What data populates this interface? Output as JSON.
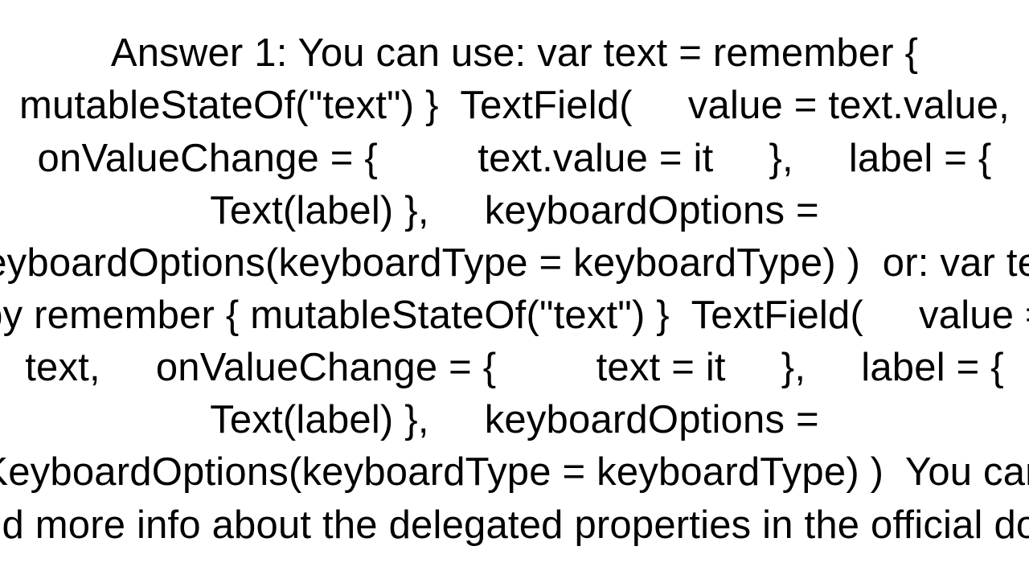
{
  "answer": {
    "text": "Answer 1: You can use: var text = remember { mutableStateOf(\"text\") }  TextField(     value = text.value,     onValueChange = {         text.value = it     },     label = { Text(label) },     keyboardOptions = KeyboardOptions(keyboardType = keyboardType) )  or: var text by remember { mutableStateOf(\"text\") }  TextField(     value = text,     onValueChange = {         text = it     },     label = { Text(label) },     keyboardOptions = KeyboardOptions(keyboardType = keyboardType) )  You can find more info about the delegated properties in the official doc."
  }
}
